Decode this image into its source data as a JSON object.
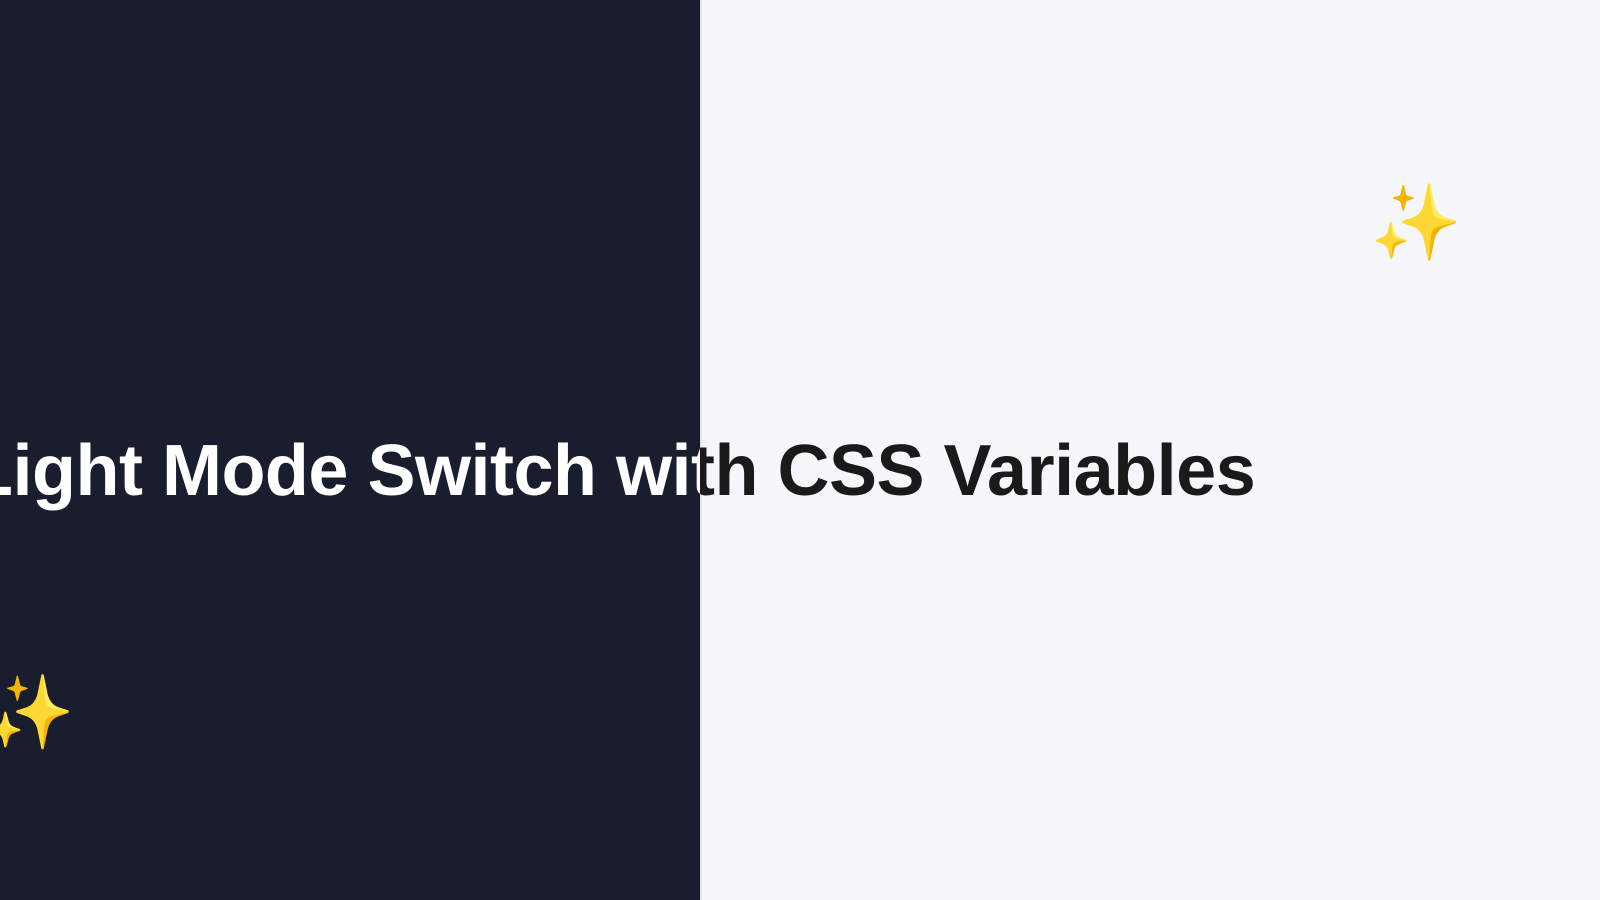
{
  "title": "k/Light Mode Switch with CSS Variables",
  "sparkles": {
    "glyph": "✨"
  },
  "colors": {
    "dark_bg": "#1a1d2e",
    "light_bg": "#f6f7fb",
    "text_dark_side": "#ffffff",
    "text_light_side": "#1a1a1a"
  }
}
